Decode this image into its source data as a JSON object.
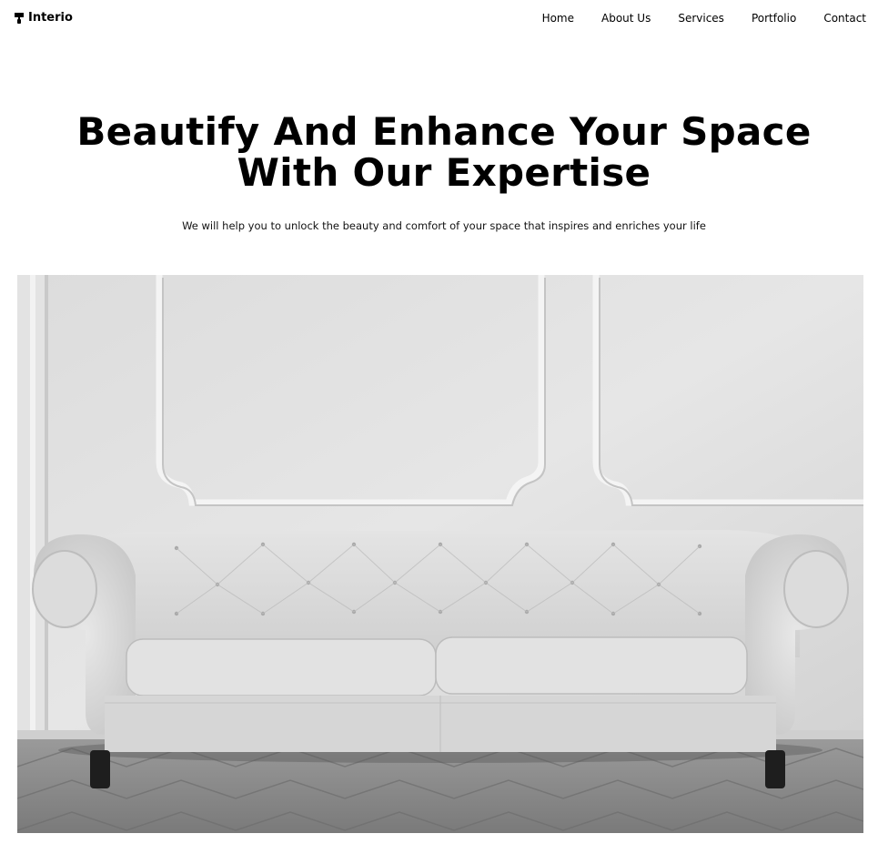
{
  "brand": {
    "name": "Interio",
    "icon": "paint-roller-icon"
  },
  "nav": {
    "items": [
      {
        "label": "Home"
      },
      {
        "label": "About Us"
      },
      {
        "label": "Services"
      },
      {
        "label": "Portfolio"
      },
      {
        "label": "Contact"
      }
    ]
  },
  "hero": {
    "title_line1": "Beautify And Enhance Your Space",
    "title_line2": "With Our Expertise",
    "subtitle": "We will help you to unlock the beauty and comfort of your space that inspires and enriches your life",
    "image": "white-tufted-sofa-photo"
  },
  "colors": {
    "text": "#000000",
    "background": "#ffffff"
  }
}
